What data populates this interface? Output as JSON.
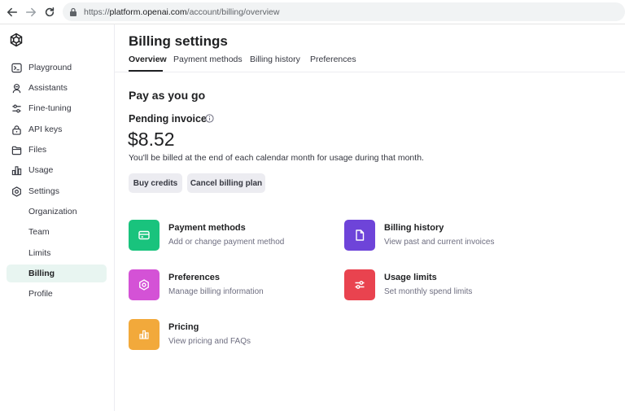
{
  "browser": {
    "url_prefix": "https://",
    "url_host": "platform.openai.com",
    "url_path": "/account/billing/overview"
  },
  "sidebar": {
    "items": [
      {
        "label": "Playground",
        "icon": "terminal-icon"
      },
      {
        "label": "Assistants",
        "icon": "robot-icon"
      },
      {
        "label": "Fine-tuning",
        "icon": "sliders-icon"
      },
      {
        "label": "API keys",
        "icon": "lock-icon"
      },
      {
        "label": "Files",
        "icon": "folder-icon"
      },
      {
        "label": "Usage",
        "icon": "bar-chart-icon"
      },
      {
        "label": "Settings",
        "icon": "gear-icon"
      }
    ],
    "settings_sub": [
      {
        "label": "Organization"
      },
      {
        "label": "Team"
      },
      {
        "label": "Limits"
      },
      {
        "label": "Billing",
        "active": true
      },
      {
        "label": "Profile"
      }
    ]
  },
  "main": {
    "title": "Billing settings",
    "tabs": [
      {
        "label": "Overview",
        "active": true
      },
      {
        "label": "Payment methods"
      },
      {
        "label": "Billing history"
      },
      {
        "label": "Preferences"
      }
    ],
    "plan_title": "Pay as you go",
    "pending_label": "Pending invoice",
    "amount": "$8.52",
    "note": "You'll be billed at the end of each calendar month for usage during that month.",
    "buttons": {
      "buy_credits": "Buy credits",
      "cancel_plan": "Cancel billing plan"
    },
    "cards": [
      {
        "title": "Payment methods",
        "subtitle": "Add or change payment method",
        "color": "#19c37d",
        "icon": "credit-card-icon"
      },
      {
        "title": "Billing history",
        "subtitle": "View past and current invoices",
        "color": "#6e44d9",
        "icon": "document-icon"
      },
      {
        "title": "Preferences",
        "subtitle": "Manage billing information",
        "color": "#d452d6",
        "icon": "gear-icon"
      },
      {
        "title": "Usage limits",
        "subtitle": "Set monthly spend limits",
        "color": "#e9434f",
        "icon": "sliders-icon"
      },
      {
        "title": "Pricing",
        "subtitle": "View pricing and FAQs",
        "color": "#f2a93b",
        "icon": "bar-chart-icon"
      }
    ]
  },
  "colors": {
    "accent_active_bg": "#e8f5f1",
    "button_bg": "#ececf1"
  }
}
